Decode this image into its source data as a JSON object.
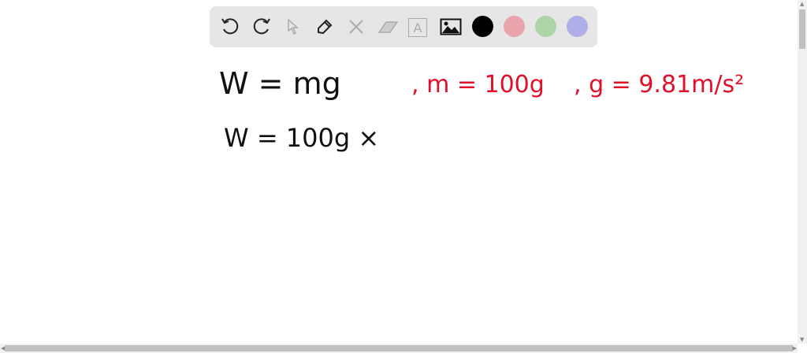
{
  "toolbar": {
    "tools": [
      "undo-icon",
      "redo-icon",
      "select-icon",
      "pen-icon",
      "tools-icon",
      "eraser-icon",
      "text-icon",
      "image-icon"
    ],
    "text_tool_glyph": "A",
    "colors": [
      "#000000",
      "#e8a3ab",
      "#aed3a8",
      "#b0aee8"
    ]
  },
  "canvas": {
    "line1": "W = mg",
    "line1_given_m": ", m = 100g",
    "line1_given_g": ", g = 9.81m/s²",
    "line2": "W = 100g ×",
    "ink_black": "#111111",
    "ink_red": "#e0102a"
  }
}
